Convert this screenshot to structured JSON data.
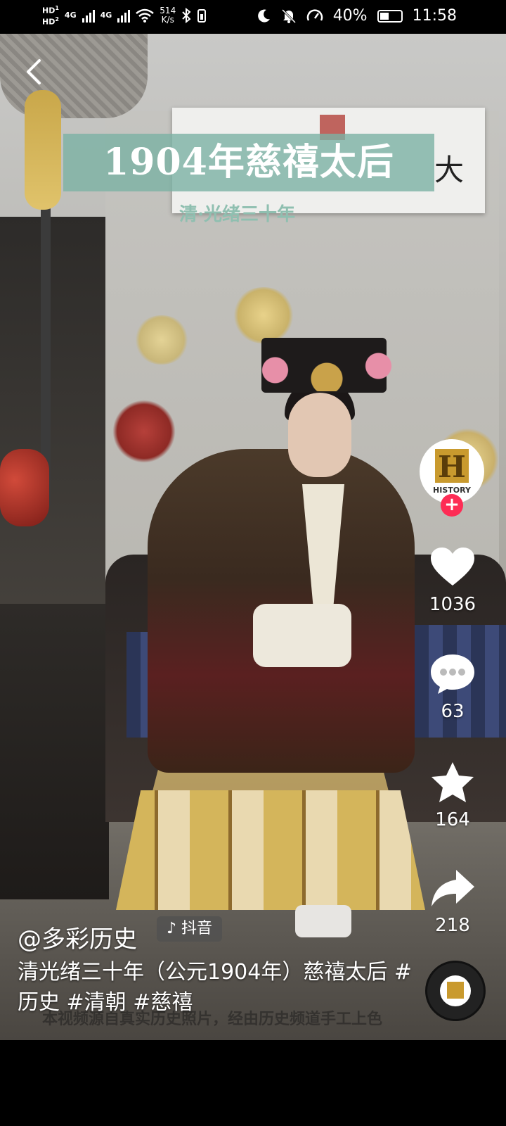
{
  "status_bar": {
    "hd1": "HD",
    "sim1": "1",
    "hd2": "HD",
    "sim2": "2",
    "signal1": "4G",
    "signal2": "4G",
    "net_speed_value": "514",
    "net_speed_unit": "K/s",
    "battery": "40%",
    "time": "11:58"
  },
  "video": {
    "title_overlay": "1904年慈禧太后",
    "subtitle_overlay": "清·光绪三十年",
    "plaque_char": "大",
    "burned_caption": "本视频源自真实历史照片，经由历史频道手工上色"
  },
  "channel_avatar": {
    "letter": "H",
    "label": "HISTORY"
  },
  "actions": {
    "likes": "1036",
    "comments": "63",
    "favorites": "164",
    "shares": "218"
  },
  "post": {
    "author": "@多彩历史",
    "platform_tag": "抖音",
    "description": "清光绪三十年（公元1904年）慈禧太后 #历史 #清朝 #慈禧"
  },
  "colors": {
    "title_band": "#7cb2a4",
    "follow_badge": "#fe2c55",
    "history_gold": "#c99a2e"
  }
}
